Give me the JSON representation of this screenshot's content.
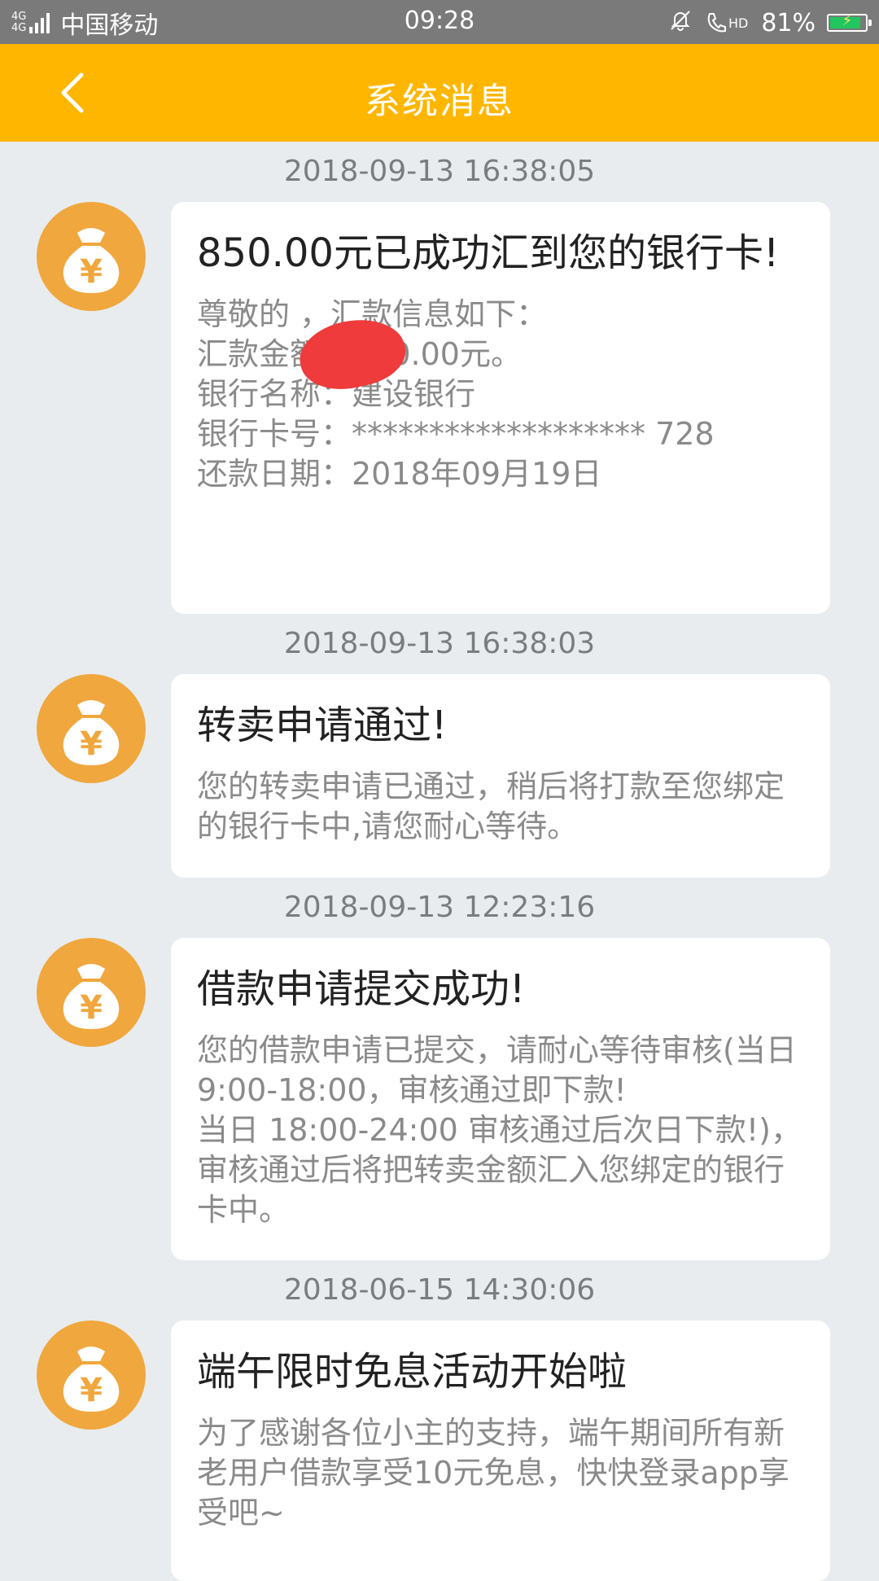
{
  "status_bar": {
    "network": "4G",
    "network2": "4G",
    "carrier": "中国移动",
    "time": "09:28",
    "hd": "HD",
    "battery": "81%",
    "battery_level": 0.81
  },
  "nav": {
    "title": "系统消息",
    "back_icon": "chevron-left-icon",
    "color": "#ffb600"
  },
  "messages": [
    {
      "time": "2018-09-13 16:38:05",
      "title": "850.00元已成功汇到您的银行卡!",
      "body": "尊敬的              ，汇款信息如下：\n汇款金额：850.00元。\n银行名称：建设银行\n银行卡号：******************* 728\n还款日期：2018年09月19日"
    },
    {
      "time": "2018-09-13 16:38:03",
      "title": "转卖申请通过!",
      "body": "您的转卖申请已通过，稍后将打款至您绑定的银行卡中,请您耐心等待。"
    },
    {
      "time": "2018-09-13 12:23:16",
      "title": "借款申请提交成功!",
      "body": "您的借款申请已提交，请耐心等待审核(当日 9:00-18:00，审核通过即下款!\n当日 18:00-24:00 审核通过后次日下款!)，审核通过后将把转卖金额汇入您绑定的银行卡中。"
    },
    {
      "time": "2018-06-15 14:30:06",
      "title": "端午限时免息活动开始啦",
      "body": "为了感谢各位小主的支持，端午期间所有新老用户借款享受10元免息，快快登录app享受吧~"
    }
  ],
  "avatar_icon": "money-bag-icon",
  "avatar_color": "#f0a73e"
}
